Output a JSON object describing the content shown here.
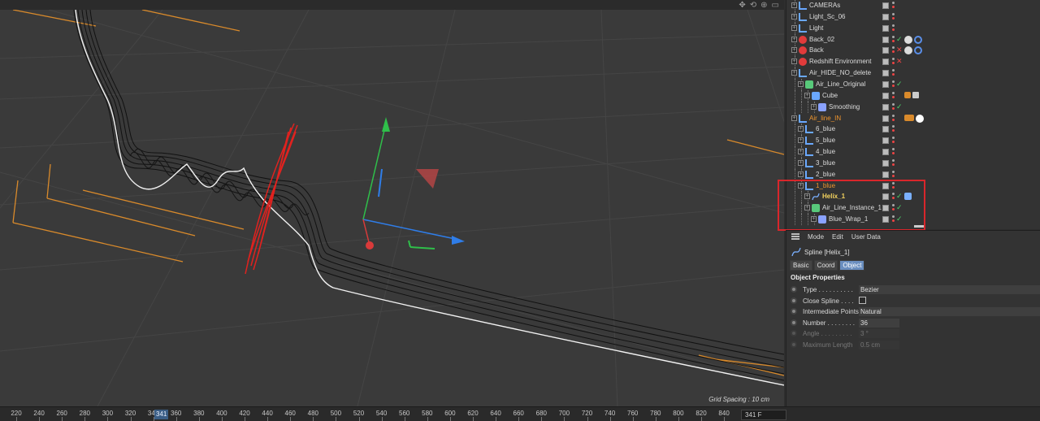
{
  "viewport": {
    "grid_spacing": "Grid Spacing : 10 cm",
    "nav_icons": [
      "move-view-icon",
      "rotate-view-icon",
      "zoom-view-icon",
      "toggle-view-icon"
    ]
  },
  "timeline": {
    "ticks": [
      "220",
      "240",
      "260",
      "280",
      "300",
      "320",
      "340",
      "341",
      "360",
      "380",
      "400",
      "420",
      "440",
      "460",
      "480",
      "500",
      "520",
      "540",
      "560",
      "580",
      "600",
      "620",
      "640",
      "660",
      "680",
      "700",
      "720",
      "740",
      "760",
      "780",
      "800",
      "820",
      "840"
    ],
    "playhead": "341",
    "current_frame": "341 F"
  },
  "object_manager": {
    "objects": [
      {
        "name": "CAMERAs",
        "level": 0,
        "icon": "null-icon",
        "style": "normal"
      },
      {
        "name": "Light_Sc_06",
        "level": 0,
        "icon": "null-icon",
        "style": "normal"
      },
      {
        "name": "Light",
        "level": 0,
        "icon": "null-icon",
        "style": "normal"
      },
      {
        "name": "Back_02",
        "level": 0,
        "icon": "redshift-object-icon",
        "style": "normal"
      },
      {
        "name": "Back",
        "level": 0,
        "icon": "redshift-object-icon",
        "style": "normal"
      },
      {
        "name": "Redshift Environment",
        "level": 0,
        "icon": "redshift-environment-icon",
        "style": "normal"
      },
      {
        "name": "Air_HIDE_NO_delete",
        "level": 0,
        "icon": "null-icon",
        "style": "normal"
      },
      {
        "name": "Air_Line_Original",
        "level": 1,
        "icon": "generator-icon",
        "style": "normal"
      },
      {
        "name": "Cube",
        "level": 2,
        "icon": "cube-icon",
        "style": "normal"
      },
      {
        "name": "Smoothing",
        "level": 3,
        "icon": "smoothing-deformer-icon",
        "style": "normal"
      },
      {
        "name": "Air_line_IN",
        "level": 0,
        "icon": "null-icon",
        "style": "orange"
      },
      {
        "name": "6_blue",
        "level": 1,
        "icon": "null-icon",
        "style": "normal"
      },
      {
        "name": "5_blue",
        "level": 1,
        "icon": "null-icon",
        "style": "normal"
      },
      {
        "name": "4_blue",
        "level": 1,
        "icon": "null-icon",
        "style": "normal"
      },
      {
        "name": "3_blue",
        "level": 1,
        "icon": "null-icon",
        "style": "normal"
      },
      {
        "name": "2_blue",
        "level": 1,
        "icon": "null-icon",
        "style": "normal"
      },
      {
        "name": "1_blue",
        "level": 1,
        "icon": "null-icon",
        "style": "orange"
      },
      {
        "name": "Helix_1",
        "level": 2,
        "icon": "spline-icon",
        "style": "highlight"
      },
      {
        "name": "Air_Line_Instance_1",
        "level": 2,
        "icon": "instance-icon",
        "style": "normal"
      },
      {
        "name": "Blue_Wrap_1",
        "level": 3,
        "icon": "spline-wrap-icon",
        "style": "normal"
      }
    ]
  },
  "attribute_manager": {
    "menu": [
      "Mode",
      "Edit",
      "User Data"
    ],
    "title": "Spline [Helix_1]",
    "tabs": [
      "Basic",
      "Coord",
      "Object"
    ],
    "active_tab": "Object",
    "section": "Object Properties",
    "properties": [
      {
        "label": "Type . . . . . . . . . .",
        "value": "Bezier",
        "kind": "dropdown",
        "enabled": true
      },
      {
        "label": "Close Spline . . . .",
        "value": "",
        "kind": "checkbox",
        "enabled": true
      },
      {
        "label": "Intermediate Points",
        "value": "Natural",
        "kind": "dropdown",
        "enabled": true
      },
      {
        "label": "Number . . . . . . . .",
        "value": "36",
        "kind": "number",
        "enabled": true
      },
      {
        "label": "Angle . . . . . . . . .",
        "value": "3 °",
        "kind": "number",
        "enabled": false
      },
      {
        "label": "Maximum Length",
        "value": "0.5 cm",
        "kind": "number",
        "enabled": false
      }
    ]
  },
  "colors": {
    "highlight_box": "#d9262b",
    "spline_red": "#e0221f",
    "axis_y": "#2fbf4a",
    "axis_x": "#2f7de8",
    "axis_z": "#d93a3a",
    "orange_lines": "#d98a2b"
  }
}
